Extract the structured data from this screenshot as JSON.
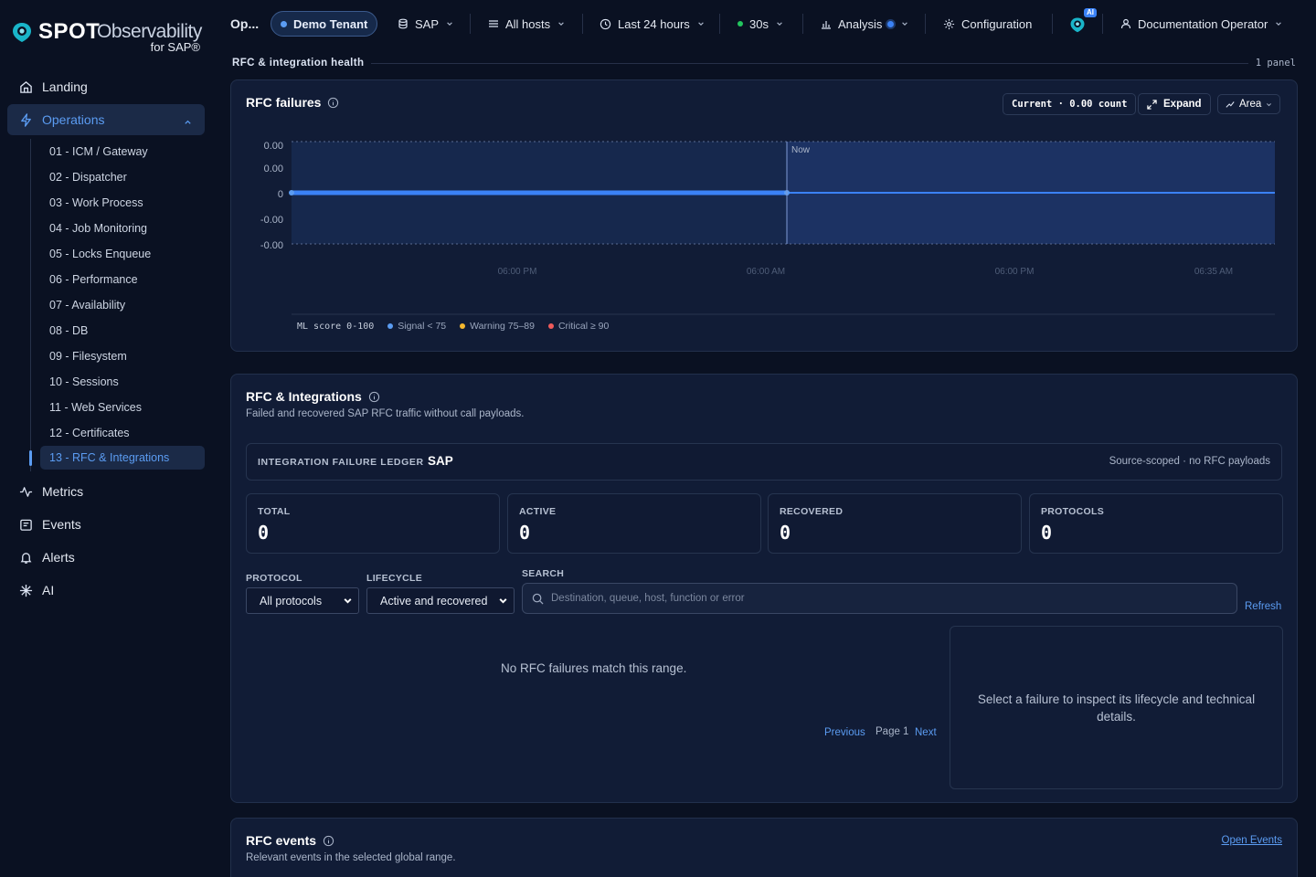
{
  "brand": {
    "name": "SPOT",
    "name2": "Observability",
    "sub": "for SAP®"
  },
  "sidebar": {
    "items": [
      {
        "label": "Landing",
        "icon": "home-icon"
      },
      {
        "label": "Operations",
        "icon": "bolt-icon"
      },
      {
        "label": "Metrics",
        "icon": "pulse-icon"
      },
      {
        "label": "Events",
        "icon": "calendar-icon"
      },
      {
        "label": "Alerts",
        "icon": "bell-icon"
      },
      {
        "label": "AI",
        "icon": "sparkle-icon"
      }
    ],
    "sub_items": [
      "01 - ICM / Gateway",
      "02 - Dispatcher",
      "03 - Work Process",
      "04 - Job Monitoring",
      "05 - Locks Enqueue",
      "06 - Performance",
      "07 - Availability",
      "08 - DB",
      "09 - Filesystem",
      "10 - Sessions",
      "11 - Web Services",
      "12 - Certificates",
      "13 - RFC & Integrations"
    ]
  },
  "topbar": {
    "page": "Op...",
    "tenant": "Demo Tenant",
    "system": "SAP",
    "hosts": "All hosts",
    "range": "Last 24 hours",
    "refresh": "30s",
    "analysis": "Analysis",
    "configuration": "Configuration",
    "ai_badge": "AI",
    "user": "Documentation Operator"
  },
  "section": {
    "title": "RFC & integration health",
    "count": "1 panel"
  },
  "rfc_failures": {
    "title": "RFC failures",
    "current": "Current · 0.00 count",
    "expand": "Expand",
    "mode": "Area",
    "now_label": "Now",
    "legend": {
      "score": "ML score 0-100",
      "signal": "Signal < 75",
      "warning": "Warning 75–89",
      "critical": "Critical ≥ 90"
    },
    "colors": {
      "line": "#3b82f6",
      "signal": "#5b9cf2",
      "warning": "#f5b82e",
      "critical": "#ef5b5b"
    }
  },
  "chart_data": {
    "type": "area",
    "y_ticks": [
      "0.00",
      "0.00",
      "0",
      "-0.00",
      "-0.00"
    ],
    "x_ticks": [
      "06:00 PM",
      "06:00 AM",
      "06:00 PM",
      "06:35 AM"
    ],
    "series": [
      {
        "values": [
          0,
          0
        ]
      }
    ]
  },
  "rfc_integrations": {
    "title": "RFC & Integrations",
    "subtitle": "Failed and recovered SAP RFC traffic without call payloads.",
    "ledger_label": "INTEGRATION FAILURE LEDGER",
    "ledger_source": "SAP",
    "ledger_note": "Source-scoped · no RFC payloads",
    "stats": [
      {
        "label": "TOTAL",
        "value": "0"
      },
      {
        "label": "ACTIVE",
        "value": "0"
      },
      {
        "label": "RECOVERED",
        "value": "0"
      },
      {
        "label": "PROTOCOLS",
        "value": "0"
      }
    ],
    "protocol_label": "PROTOCOL",
    "protocol_value": "All protocols",
    "lifecycle_label": "LIFECYCLE",
    "lifecycle_value": "Active and recovered",
    "search_label": "SEARCH",
    "search_placeholder": "Destination, queue, host, function or error",
    "refresh": "Refresh",
    "empty": "No RFC failures match this range.",
    "previous": "Previous",
    "page": "Page 1",
    "next": "Next",
    "detail_msg": "Select a failure to inspect its lifecycle and technical details."
  },
  "rfc_events": {
    "title": "RFC events",
    "subtitle": "Relevant events in the selected global range.",
    "open": "Open Events"
  }
}
